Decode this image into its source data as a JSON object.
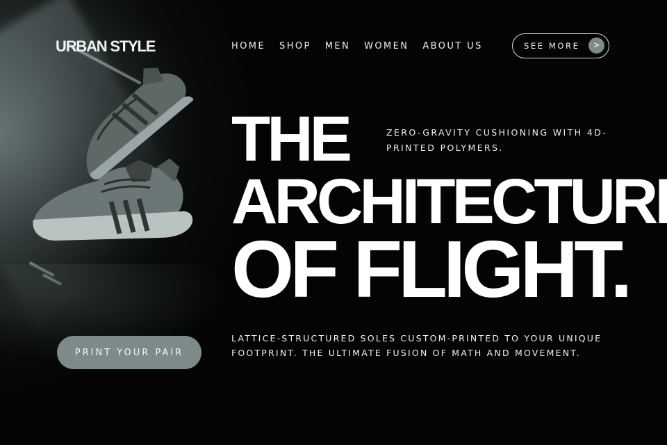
{
  "brand": {
    "logo": "URBAN STYLE"
  },
  "nav": {
    "items": [
      {
        "label": "HOME"
      },
      {
        "label": "SHOP"
      },
      {
        "label": "MEN"
      },
      {
        "label": "WOMEN"
      },
      {
        "label": "ABOUT US"
      }
    ],
    "see_more_label": "SEE MORE",
    "see_more_arrow": ">"
  },
  "hero": {
    "headline_line1": "THE",
    "headline_line2": "ARCHITECTURE",
    "headline_line3": "OF FLIGHT.",
    "tagline": "ZERO-GRAVITY CUSHIONING WITH 4D-PRINTED POLYMERS.",
    "description": "LATTICE-STRUCTURED SOLES CUSTOM-PRINTED TO YOUR UNIQUE FOOTPRINT. THE ULTIMATE FUSION OF MATH AND MOVEMENT.",
    "cta_label": "PRINT YOUR PAIR"
  },
  "colors": {
    "background": "#050505",
    "accent": "#7c8a89",
    "text": "#ffffff"
  },
  "icons": {
    "see_more_arrow": "chevron-right-icon",
    "hero_image": "sneakers-image"
  }
}
